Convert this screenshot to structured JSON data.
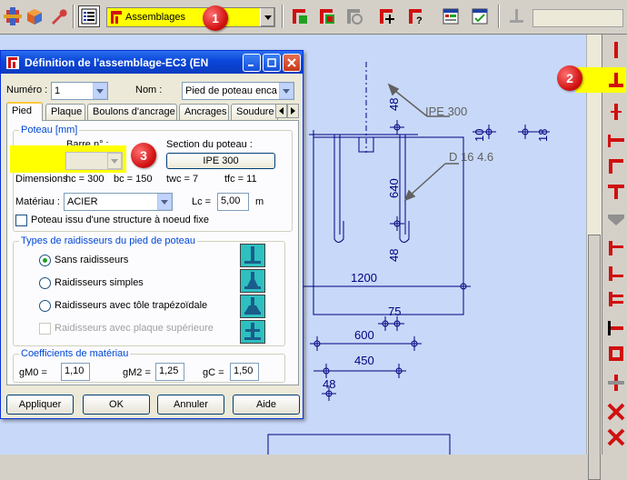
{
  "toolbar": {
    "combo_value": "Assemblages",
    "buttons": [
      "assembly-icon",
      "tools-wrench-icon",
      "properties-icon",
      "new-connection-icon",
      "delete-connection-icon",
      "refresh-icon",
      "add-connection-icon",
      "help-connection-icon",
      "list-icon",
      "check-list-icon",
      "base-plate-icon"
    ]
  },
  "markers": {
    "m1": "1",
    "m2": "2",
    "m3": "3"
  },
  "dialog": {
    "title": "Définition de l'assemblage-EC3 (EN",
    "numero_label": "Numéro :",
    "numero_value": "1",
    "nom_label": "Nom :",
    "nom_value": "Pied de poteau enca",
    "tabs": [
      "Pied",
      "Plaque",
      "Boulons d'ancrage",
      "Ancrages",
      "Soudure"
    ],
    "active_tab": "Pied",
    "poteau": {
      "group_title": "Poteau [mm]",
      "barre_label": "Barre n° :",
      "section_label": "Section du poteau :",
      "section_value": "IPE 300",
      "dims_label": "Dimensions",
      "hc": "hc = 300",
      "bc": "bc = 150",
      "twc": "twc = 7",
      "tfc": "tfc = 11",
      "materiau_label": "Matériau :",
      "materiau_value": "ACIER",
      "lc_label": "Lc =",
      "lc_value": "5,00",
      "lc_unit": "m",
      "checkbox_label": "Poteau issu d'une structure à noeud fixe"
    },
    "raidisseurs": {
      "group_title": "Types de raidisseurs du pied de poteau",
      "options": [
        "Sans raidisseurs",
        "Raidisseurs simples",
        "Raidisseurs avec tôle trapézoïdale"
      ],
      "selected": "Sans raidisseurs",
      "disabled_option": "Raidisseurs avec plaque supérieure"
    },
    "coefficients": {
      "group_title": "Coefficients de matériau",
      "gm0_label": "gM0 =",
      "gm0_value": "1,10",
      "gm2_label": "gM2 =",
      "gm2_value": "1,25",
      "gc_label": "gC =",
      "gc_value": "1,50"
    },
    "buttons": {
      "apply": "Appliquer",
      "ok": "OK",
      "cancel": "Annuler",
      "help": "Aide"
    }
  },
  "drawing": {
    "labels": {
      "ipe": "IPE 300",
      "bolt": "D 16    4.6",
      "dim_48a": "48",
      "dim_10": "10",
      "dim_18": "18",
      "dim_640": "640",
      "dim_48b": "48",
      "dim_1200": "1200",
      "dim_75": "75",
      "dim_600": "600",
      "dim_450": "450",
      "dim_48c": "48"
    },
    "colors": {
      "background": "#c8d8f8",
      "lines": "#000080",
      "leader": "#606060"
    }
  }
}
